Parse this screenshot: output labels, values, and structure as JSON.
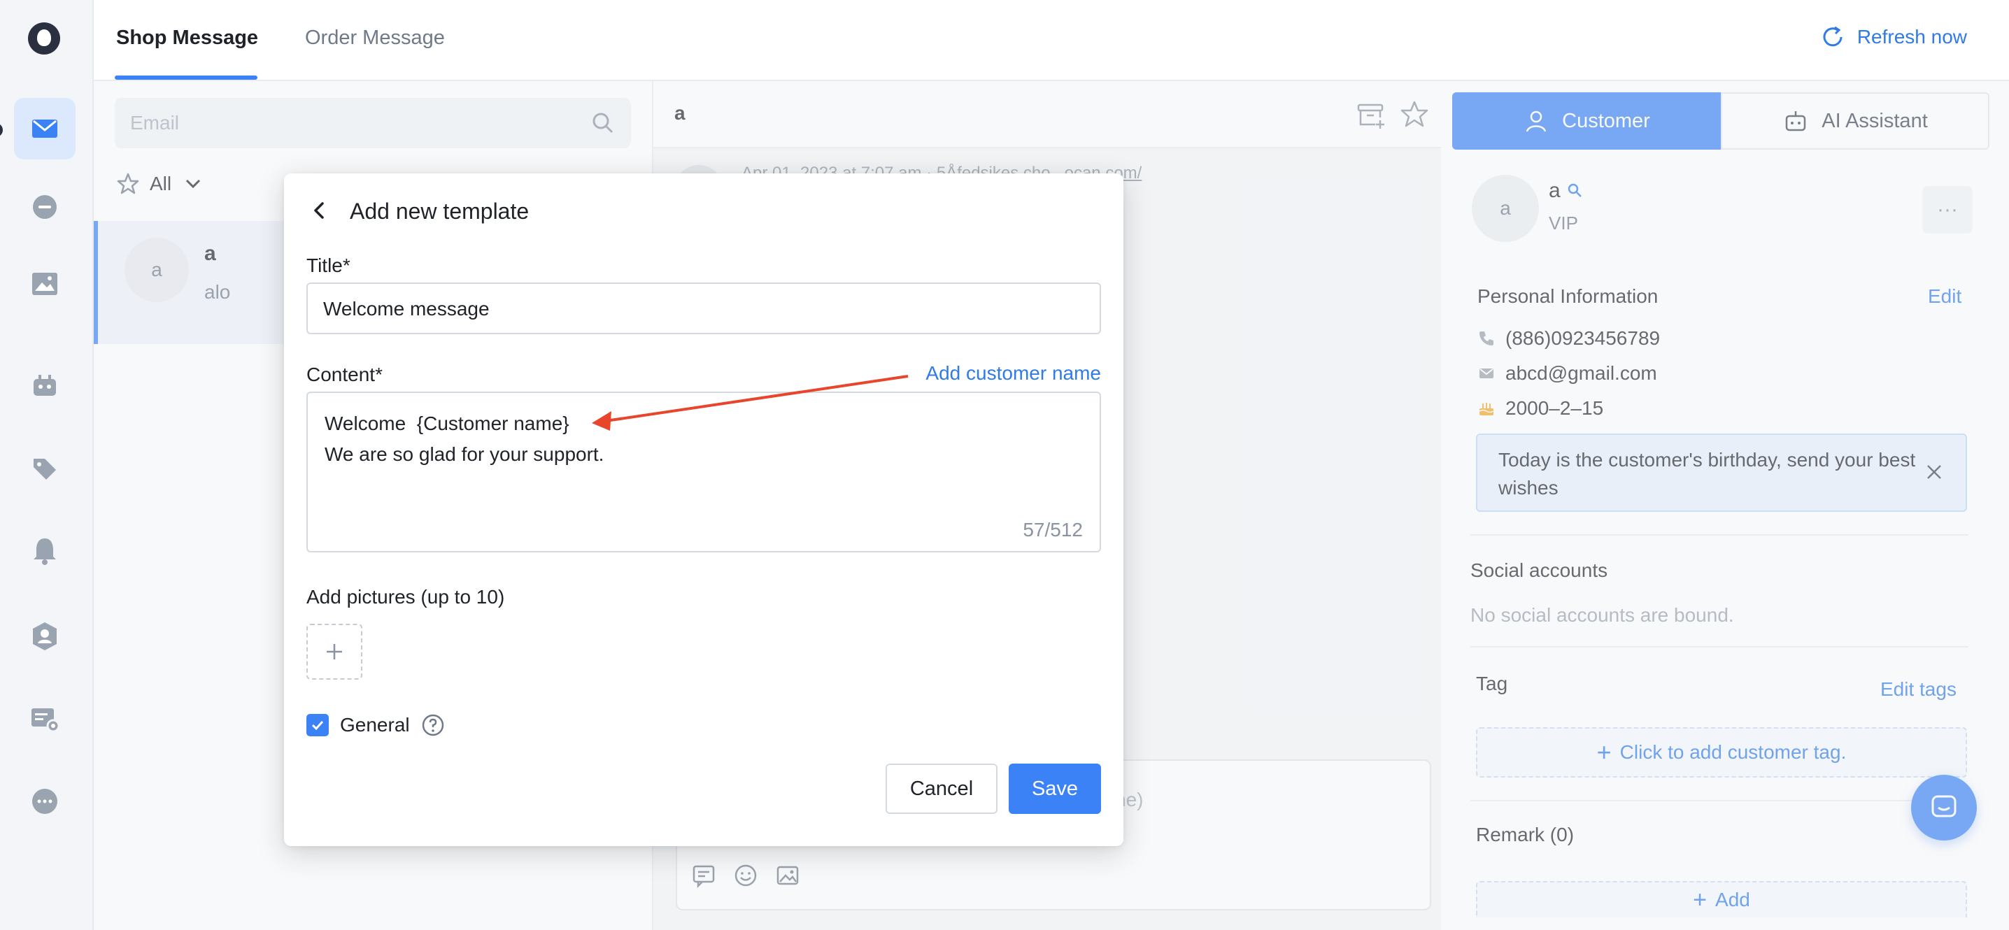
{
  "colors": {
    "accent": "#3b82f6",
    "link": "#2f7be8",
    "annotation_arrow": "#e8452c"
  },
  "rail": {
    "items": [
      "mail-icon",
      "chat-bubble-icon",
      "image-icon",
      "robot-icon",
      "tag-icon",
      "bell-icon",
      "user-shield-icon",
      "settings-card-icon",
      "more-icon"
    ],
    "active": "mail-icon"
  },
  "topbar": {
    "tabs": [
      {
        "label": "Shop Message",
        "active": true
      },
      {
        "label": "Order Message",
        "active": false
      }
    ],
    "refresh_label": "Refresh now"
  },
  "list": {
    "search_placeholder": "Email",
    "filter_label": "All",
    "conversations": [
      {
        "avatar": "a",
        "name": "a",
        "preview": "alo"
      }
    ]
  },
  "chat": {
    "title": "a",
    "meta_line": "Apr 01, 2023 at 7:07 am · 5Åfedsikes.cho...ocan.com/",
    "composer_placeholder": "ne)"
  },
  "customer_panel": {
    "tabs": [
      {
        "label": "Customer",
        "active": true
      },
      {
        "label": "AI Assistant",
        "active": false
      }
    ],
    "avatar": "a",
    "name": "a",
    "level": "VIP",
    "more": "···",
    "personal_info_title": "Personal Information",
    "edit_label": "Edit",
    "phone": "(886)0923456789",
    "email": "abcd@gmail.com",
    "birthday": "2000–2–15",
    "birthday_notice": "Today is the customer's birthday, send your best wishes",
    "social_title": "Social accounts",
    "social_empty": "No social accounts are bound.",
    "tag_title": "Tag",
    "edit_tags_label": "Edit tags",
    "add_tag_label": "Click to add customer tag.",
    "remark_title": "Remark (0)",
    "add_label": "Add"
  },
  "modal": {
    "title": "Add new template",
    "title_field_label": "Title*",
    "title_value": "Welcome message",
    "content_label": "Content*",
    "add_customer_name": "Add customer name",
    "content_lines": [
      "Welcome  {Customer name}",
      "We are so glad for your support."
    ],
    "char_count": "57/512",
    "pictures_label": "Add pictures (up to 10)",
    "general_label": "General",
    "general_checked": true,
    "cancel_label": "Cancel",
    "save_label": "Save"
  }
}
